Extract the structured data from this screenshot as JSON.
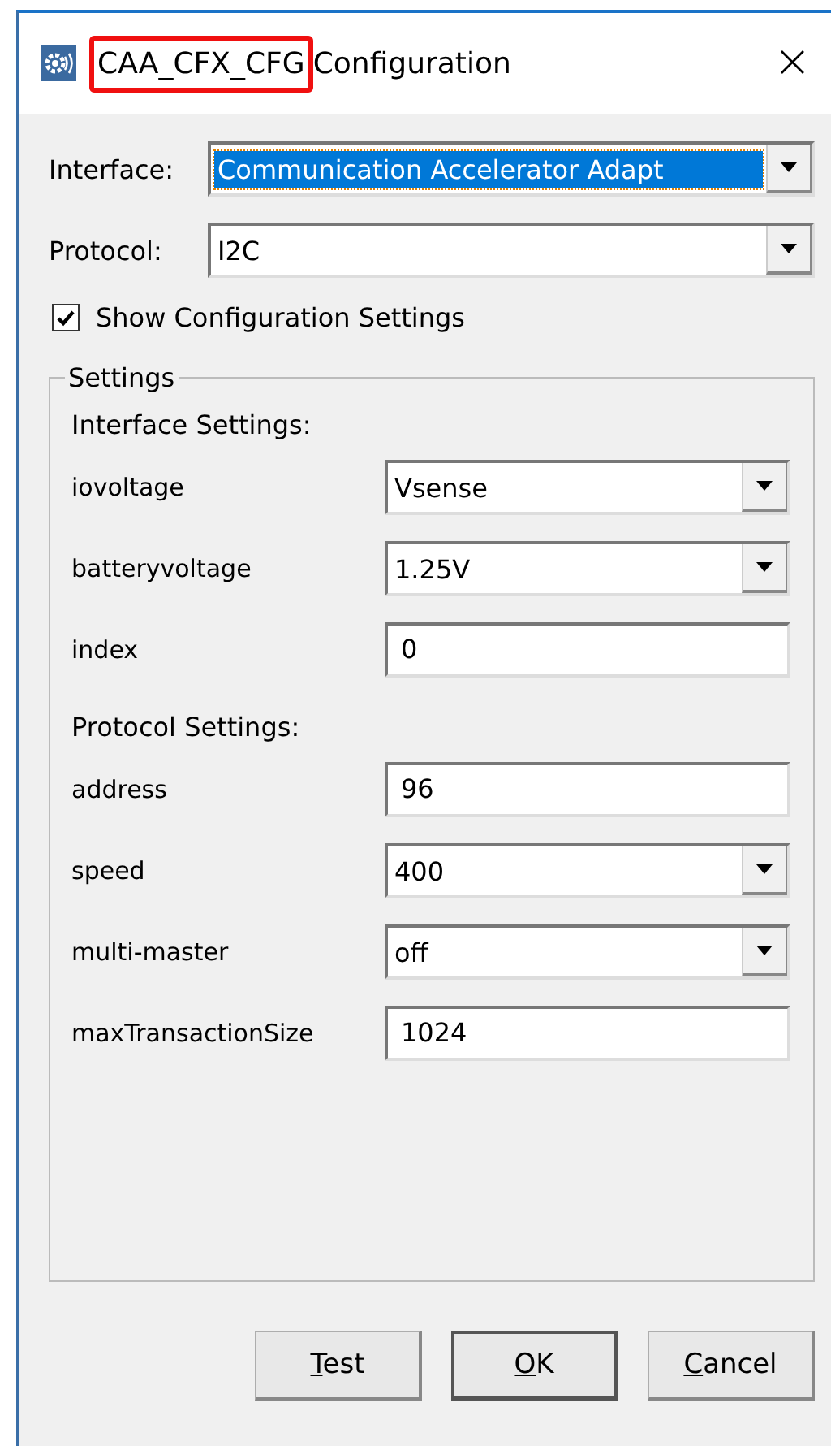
{
  "window": {
    "title_highlighted": "CAA_CFX_CFG",
    "title": "Configuration",
    "highlight": true,
    "close": "×"
  },
  "interface": {
    "label": "Interface:",
    "value": "Communication Accelerator Adapt",
    "selected": true
  },
  "protocol": {
    "label": "Protocol:",
    "value": "I2C"
  },
  "show_settings": {
    "label": "Show Configuration Settings",
    "checked": true
  },
  "settings": {
    "title": "Settings",
    "rows": [
      {
        "kind": "heading",
        "label": "Interface Settings:"
      },
      {
        "kind": "select",
        "label": "iovoltage",
        "value": "Vsense"
      },
      {
        "kind": "select",
        "label": "batteryvoltage",
        "value": "1.25V"
      },
      {
        "kind": "text",
        "label": "index",
        "value": "0"
      },
      {
        "kind": "heading",
        "label": "Protocol Settings:"
      },
      {
        "kind": "text",
        "label": "address",
        "value": "96"
      },
      {
        "kind": "select",
        "label": "speed",
        "value": "400"
      },
      {
        "kind": "select",
        "label": "multi-master",
        "value": "off"
      },
      {
        "kind": "text",
        "label": "maxTransactionSize",
        "value": "1024"
      }
    ]
  },
  "buttons": [
    {
      "label": "Test",
      "default": false
    },
    {
      "label": "OK",
      "default": true
    },
    {
      "label": "Cancel",
      "default": false
    }
  ]
}
